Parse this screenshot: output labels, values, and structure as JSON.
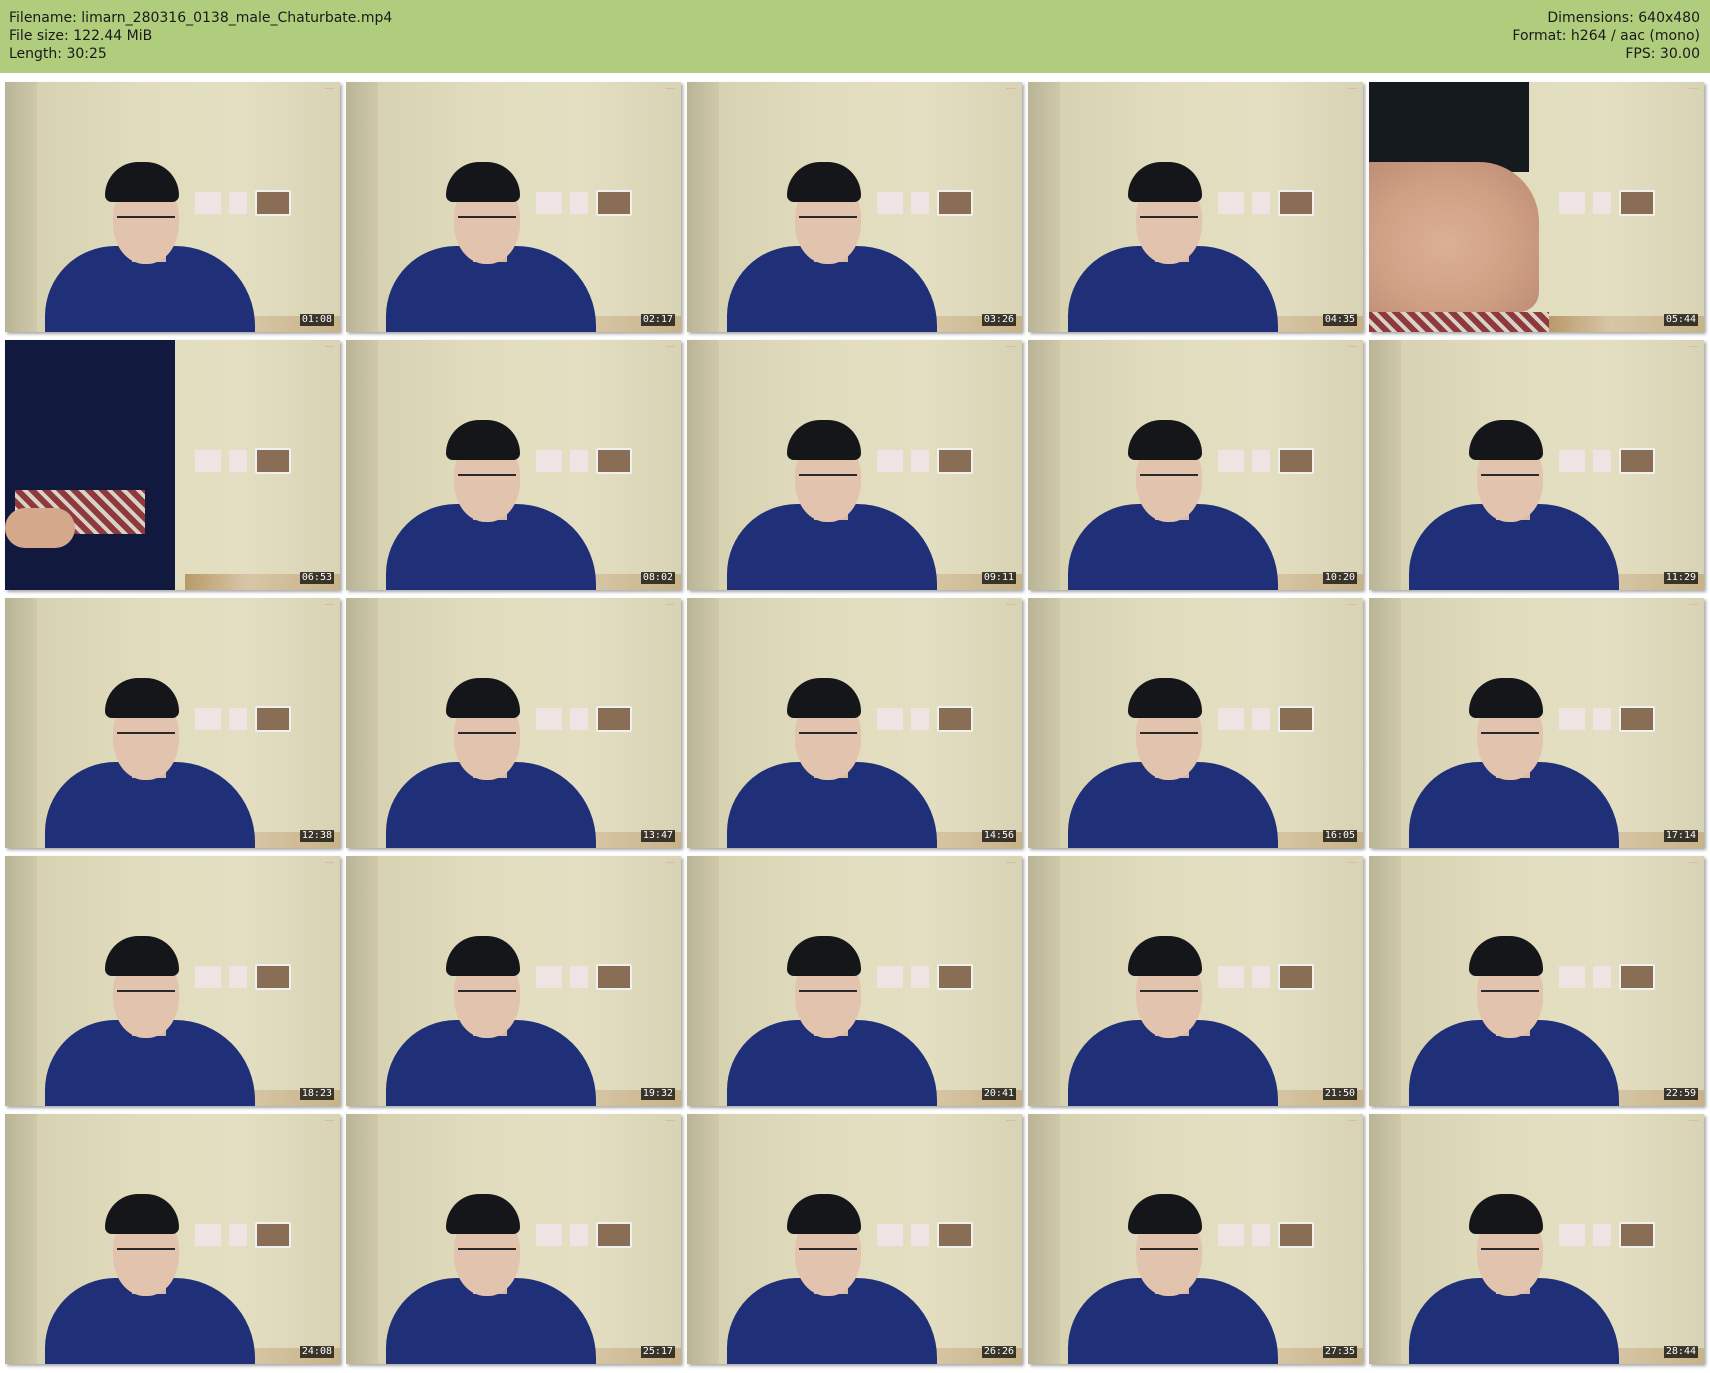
{
  "header": {
    "filename": "Filename: limarn_280316_0138_male_Chaturbate.mp4",
    "filesize": "File size: 122.44 MiB",
    "length": "Length: 30:25",
    "dimensions": "Dimensions: 640x480",
    "format": "Format: h264 / aac (mono)",
    "fps": "FPS: 30.00",
    "background_color": "#b0cc7d"
  },
  "thumbnails": [
    {
      "time": "01:08",
      "scene": "person"
    },
    {
      "time": "02:17",
      "scene": "person"
    },
    {
      "time": "03:26",
      "scene": "person"
    },
    {
      "time": "04:35",
      "scene": "person"
    },
    {
      "time": "05:44",
      "scene": "closeup"
    },
    {
      "time": "06:53",
      "scene": "standing"
    },
    {
      "time": "08:02",
      "scene": "person"
    },
    {
      "time": "09:11",
      "scene": "person"
    },
    {
      "time": "10:20",
      "scene": "person"
    },
    {
      "time": "11:29",
      "scene": "person"
    },
    {
      "time": "12:38",
      "scene": "person"
    },
    {
      "time": "13:47",
      "scene": "person"
    },
    {
      "time": "14:56",
      "scene": "person"
    },
    {
      "time": "16:05",
      "scene": "person"
    },
    {
      "time": "17:14",
      "scene": "person"
    },
    {
      "time": "18:23",
      "scene": "person"
    },
    {
      "time": "19:32",
      "scene": "person"
    },
    {
      "time": "20:41",
      "scene": "person"
    },
    {
      "time": "21:50",
      "scene": "person"
    },
    {
      "time": "22:59",
      "scene": "person"
    },
    {
      "time": "24:08",
      "scene": "person"
    },
    {
      "time": "25:17",
      "scene": "person"
    },
    {
      "time": "26:26",
      "scene": "person"
    },
    {
      "time": "27:35",
      "scene": "person"
    },
    {
      "time": "28:44",
      "scene": "person"
    }
  ]
}
